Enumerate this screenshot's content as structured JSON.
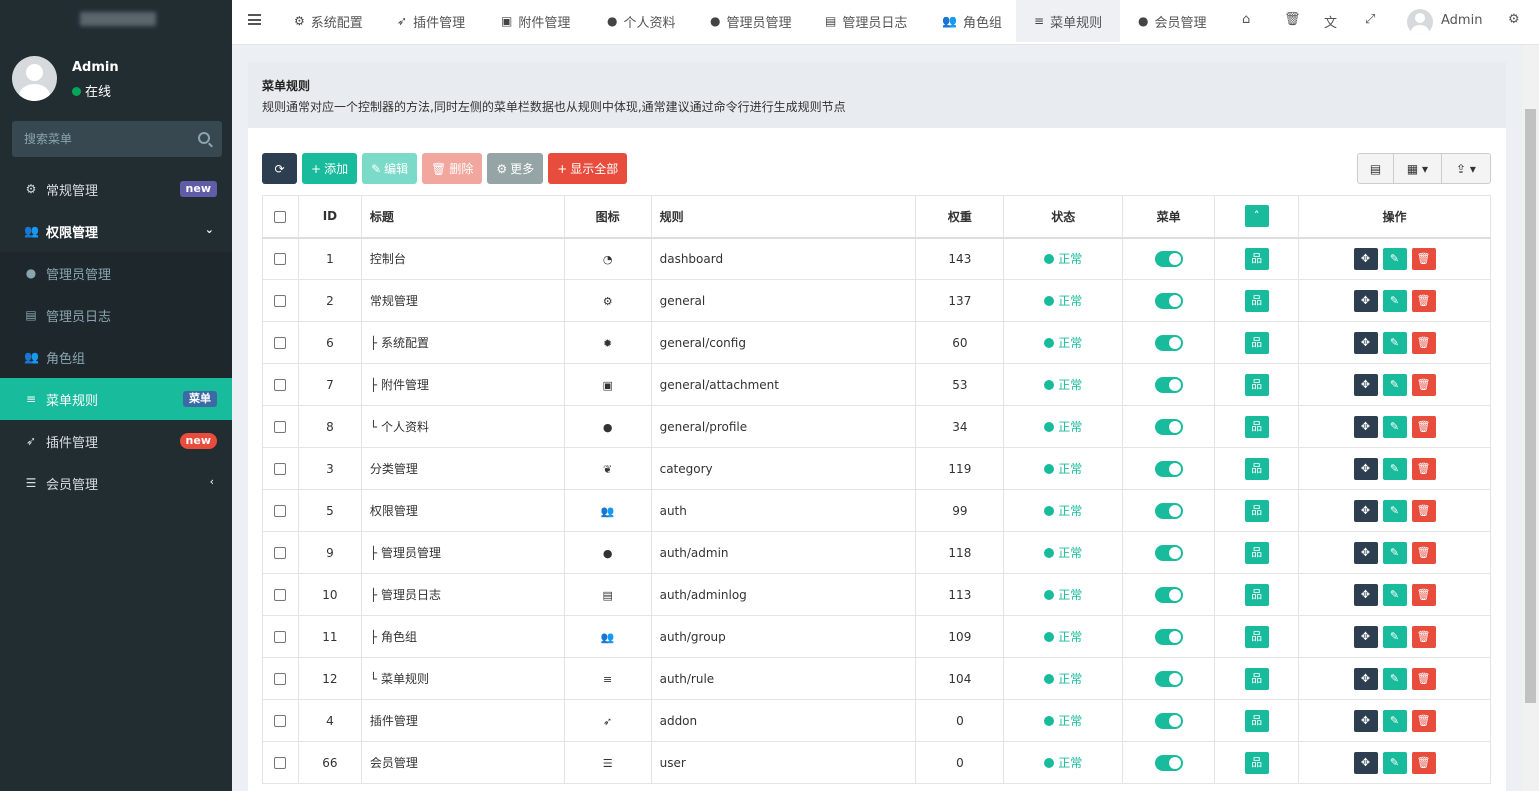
{
  "sidebar": {
    "user": {
      "name": "Admin",
      "status": "在线"
    },
    "search_placeholder": "搜索菜单",
    "items": [
      {
        "label": "常规管理",
        "icon": "cogs-icon",
        "badge": "new"
      },
      {
        "label": "权限管理",
        "icon": "users-icon"
      },
      {
        "label": "管理员管理",
        "icon": "user-icon"
      },
      {
        "label": "管理员日志",
        "icon": "list-alt-icon"
      },
      {
        "label": "角色组",
        "icon": "group-icon"
      },
      {
        "label": "菜单规则",
        "icon": "bars-icon",
        "badge": "菜单"
      },
      {
        "label": "插件管理",
        "icon": "rocket-icon",
        "badge": "new"
      },
      {
        "label": "会员管理",
        "icon": "list-icon"
      }
    ]
  },
  "topnav": {
    "tabs": [
      {
        "label": "系统配置",
        "icon": "cog-icon"
      },
      {
        "label": "插件管理",
        "icon": "rocket-icon"
      },
      {
        "label": "附件管理",
        "icon": "file-image-icon"
      },
      {
        "label": "个人资料",
        "icon": "user-icon"
      },
      {
        "label": "管理员管理",
        "icon": "user-icon"
      },
      {
        "label": "管理员日志",
        "icon": "list-alt-icon"
      },
      {
        "label": "角色组",
        "icon": "group-icon"
      },
      {
        "label": "菜单规则",
        "icon": "bars-icon"
      },
      {
        "label": "会员管理",
        "icon": "user-icon"
      }
    ],
    "admin_name": "Admin"
  },
  "header": {
    "title": "菜单规则",
    "description": "规则通常对应一个控制器的方法,同时左侧的菜单栏数据也从规则中体现,通常建议通过命令行进行生成规则节点"
  },
  "toolbar": {
    "refresh": "",
    "add": "添加",
    "edit": "编辑",
    "delete": "删除",
    "more": "更多",
    "show_all": "显示全部"
  },
  "table": {
    "columns": [
      "ID",
      "标题",
      "图标",
      "规则",
      "权重",
      "状态",
      "菜单",
      "",
      "操作"
    ],
    "status_label": "正常",
    "rows": [
      {
        "id": "1",
        "title": "控制台",
        "icon": "dashboard-icon",
        "rule": "dashboard",
        "weight": "143"
      },
      {
        "id": "2",
        "title": "常规管理",
        "icon": "cogs-icon",
        "rule": "general",
        "weight": "137"
      },
      {
        "id": "6",
        "title": "├ 系统配置",
        "icon": "cog-icon",
        "rule": "general/config",
        "weight": "60"
      },
      {
        "id": "7",
        "title": "├ 附件管理",
        "icon": "file-image-icon",
        "rule": "general/attachment",
        "weight": "53"
      },
      {
        "id": "8",
        "title": "└ 个人资料",
        "icon": "user-icon",
        "rule": "general/profile",
        "weight": "34"
      },
      {
        "id": "3",
        "title": "分类管理",
        "icon": "leaf-icon",
        "rule": "category",
        "weight": "119"
      },
      {
        "id": "5",
        "title": "权限管理",
        "icon": "group-icon",
        "rule": "auth",
        "weight": "99"
      },
      {
        "id": "9",
        "title": "├ 管理员管理",
        "icon": "user-icon",
        "rule": "auth/admin",
        "weight": "118"
      },
      {
        "id": "10",
        "title": "├ 管理员日志",
        "icon": "list-alt-icon",
        "rule": "auth/adminlog",
        "weight": "113"
      },
      {
        "id": "11",
        "title": "├ 角色组",
        "icon": "group-icon",
        "rule": "auth/group",
        "weight": "109"
      },
      {
        "id": "12",
        "title": "└ 菜单规则",
        "icon": "bars-icon",
        "rule": "auth/rule",
        "weight": "104"
      },
      {
        "id": "4",
        "title": "插件管理",
        "icon": "rocket-icon",
        "rule": "addon",
        "weight": "0"
      },
      {
        "id": "66",
        "title": "会员管理",
        "icon": "list-icon",
        "rule": "user",
        "weight": "0"
      }
    ]
  },
  "colors": {
    "sidebar_bg": "#222d32",
    "accent": "#18bc9c",
    "danger": "#e74c3c",
    "dark": "#2c3e50"
  }
}
